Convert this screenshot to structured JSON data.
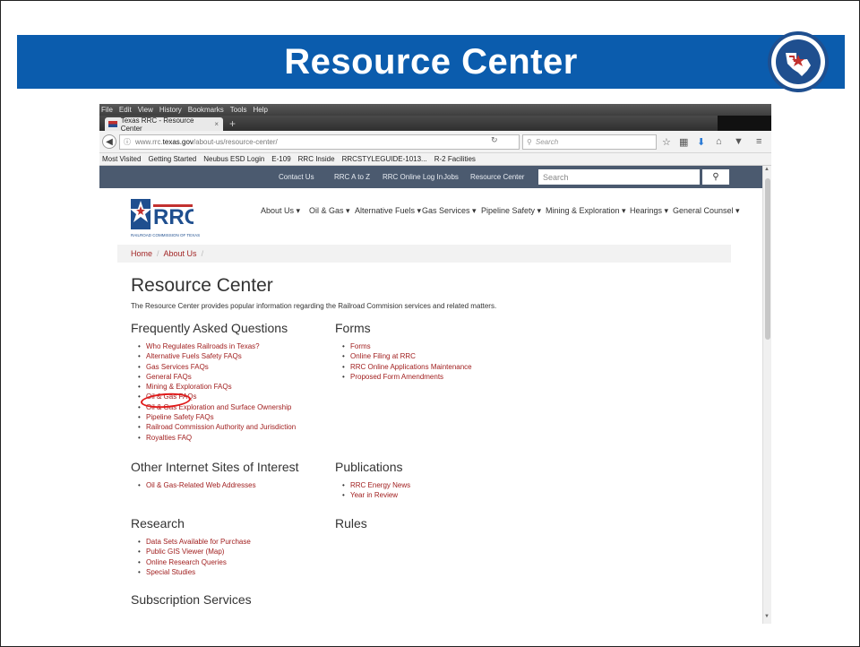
{
  "slide": {
    "title": "Resource Center",
    "seal_text": "RAILROAD COMMISSION OF TEXAS"
  },
  "browser": {
    "menu": [
      "File",
      "Edit",
      "View",
      "History",
      "Bookmarks",
      "Tools",
      "Help"
    ],
    "tab_title": "Texas RRC - Resource Center",
    "tab_close": "×",
    "new_tab": "+",
    "url_prefix": "www.rrc.",
    "url_host": "texas.gov",
    "url_path": "/about-us/resource-center/",
    "search_placeholder": "Search",
    "bookmarks": [
      "Most Visited",
      "Getting Started",
      "Neubus ESD Login",
      "E-109",
      "RRC Inside",
      "RRCSTYLEGUIDE-1013...",
      "R-2 Facilities"
    ]
  },
  "site": {
    "utility_links": [
      "Contact Us",
      "RRC A to Z",
      "RRC Online Log In",
      "Jobs",
      "Resource Center"
    ],
    "search_placeholder": "Search",
    "logo_text": "RRC",
    "logo_sub": "RAILROAD COMMISSION OF TEXAS",
    "main_nav": [
      "About Us",
      "Oil & Gas",
      "Alternative Fuels",
      "Gas Services",
      "Pipeline Safety",
      "Mining & Exploration",
      "Hearings",
      "General Counsel"
    ],
    "breadcrumb": [
      "Home",
      "About Us"
    ],
    "page_title": "Resource Center",
    "intro": "The Resource Center provides popular information regarding the Railroad Commision services and related matters."
  },
  "sections": {
    "faq": {
      "title": "Frequently Asked Questions",
      "items": [
        "Who Regulates Railroads in Texas?",
        "Alternative Fuels Safety FAQs",
        "Gas Services FAQs",
        "General FAQs",
        "Mining & Exploration FAQs",
        "Oil & Gas FAQs",
        "Oil & Gas Exploration and Surface Ownership",
        "Pipeline Safety FAQs",
        "Railroad Commission Authority and Jurisdiction",
        "Royalties FAQ"
      ]
    },
    "forms": {
      "title": "Forms",
      "items": [
        "Forms",
        "Online Filing at RRC",
        "RRC Online Applications Maintenance",
        "Proposed Form Amendments"
      ]
    },
    "other_sites": {
      "title": "Other Internet Sites of Interest",
      "items": [
        "Oil & Gas-Related Web Addresses"
      ]
    },
    "publications": {
      "title": "Publications",
      "items": [
        "RRC Energy News",
        "Year in Review"
      ]
    },
    "research": {
      "title": "Research",
      "items": [
        "Data Sets Available for Purchase",
        "Public GIS Viewer (Map)",
        "Online Research Queries",
        "Special Studies"
      ]
    },
    "rules": {
      "title": "Rules"
    },
    "subscription": {
      "title": "Subscription Services"
    }
  },
  "colors": {
    "title_bar": "#0b5cad",
    "utility_bar": "#4b5a6f",
    "link": "#a11f1f",
    "highlight_circle": "#e11a1a"
  }
}
